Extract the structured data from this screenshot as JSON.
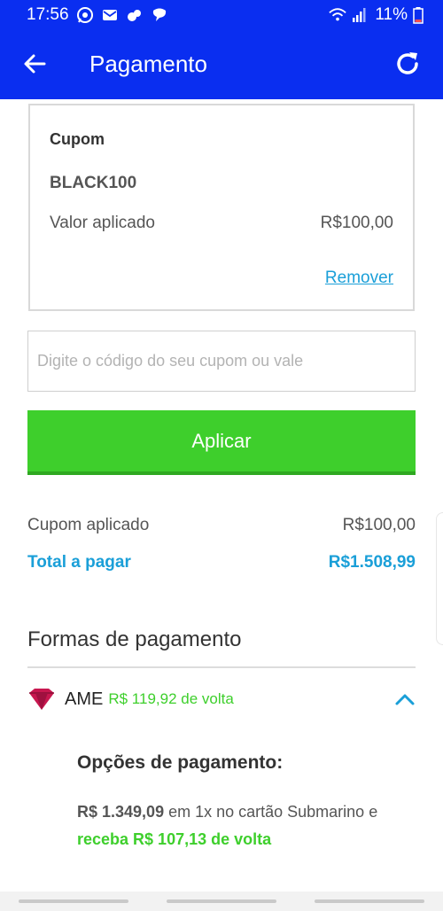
{
  "status_bar": {
    "time": "17:56",
    "battery": "11%",
    "icons": [
      "whatsapp-icon",
      "mail-icon",
      "app-icon",
      "chat-icon",
      "wifi-icon",
      "signal-icon",
      "battery-icon"
    ]
  },
  "app_bar": {
    "title": "Pagamento",
    "back_icon": "arrow-left-icon",
    "refresh_icon": "refresh-icon"
  },
  "coupon_card": {
    "title": "Cupom",
    "code": "BLACK100",
    "applied_label": "Valor aplicado",
    "applied_value": "R$100,00",
    "remove_label": "Remover"
  },
  "coupon_input": {
    "value": "",
    "placeholder": "Digite o código do seu cupom ou vale"
  },
  "apply_button": {
    "label": "Aplicar"
  },
  "summary": {
    "coupon_label": "Cupom aplicado",
    "coupon_value": "R$100,00",
    "total_label": "Total a pagar",
    "total_value": "R$1.508,99"
  },
  "payment_section": {
    "title": "Formas de pagamento",
    "method": {
      "name": "AME",
      "cashback": "R$ 119,92 de volta",
      "expanded": true
    },
    "options": {
      "title": "Opções de pagamento:",
      "price": "R$ 1.349,09",
      "text_1": " em 1x no cartão Submarino e ",
      "cashback_text": "receba R$ 107,13 de volta"
    }
  },
  "colors": {
    "primary_blue": "#0a2ef0",
    "accent_green": "#3ecf2c",
    "link_blue": "#1a9fd8",
    "ame_logo": "#c8174f"
  }
}
